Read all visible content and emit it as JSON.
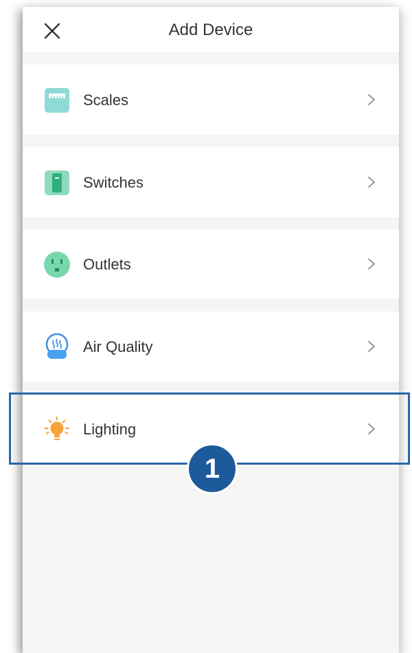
{
  "header": {
    "title": "Add Device",
    "close_icon": "close-icon"
  },
  "devices": [
    {
      "label": "Scales",
      "icon": "scale-icon",
      "color": "#7fd6d0"
    },
    {
      "label": "Switches",
      "icon": "switch-icon",
      "color": "#3fbf8f"
    },
    {
      "label": "Outlets",
      "icon": "outlet-icon",
      "color": "#5ed0a0"
    },
    {
      "label": "Air Quality",
      "icon": "air-purifier-icon",
      "color": "#3b8fe6"
    },
    {
      "label": "Lighting",
      "icon": "light-bulb-icon",
      "color": "#f7a23a"
    }
  ],
  "callout": {
    "step_number": "1",
    "highlight_color": "#2a67a8"
  }
}
